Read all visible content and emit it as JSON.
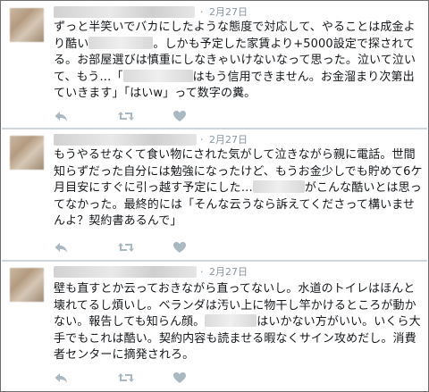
{
  "tweets": [
    {
      "date": "2月27日",
      "text": [
        "ずっと半笑いでバカにしたような態度で対応して、やることは成金より酷い",
        "。しかも予定した家賃より+5000設定で探されてる。お部屋選びは慎重にしなきゃいけないなって思った。泣いて泣いて、もう…「",
        "はもう信用できません。お金溜まり次第出ていきます」「はいw」って数字の糞。"
      ]
    },
    {
      "date": "2月27日",
      "text": [
        "もうやるせなくて食い物にされた気がして泣きながら親に電話。世間知らずだった自分には勉強になったけど、もうお金少しでも貯めて6ケ月目安にすぐに引っ越す予定にした…",
        "がこんな酷いとは思ってなかった。最終的には「そんな云うなら訴えてくださって構いませんよ？契約書あるんで」"
      ]
    },
    {
      "date": "2月27日",
      "text": [
        "壁も直すとか云っておきながら直ってないし。水道のトイレはほんと壊れてるし煩いし。ベランダは汚い上に物干し竿かけるところが動かない。報告しても知らん顔。",
        "はいかない方がいい。いくら大手でもこれは酷い。契約内容も読ませる暇なくサイン攻めだし。消費者センターに摘発されろ。"
      ]
    }
  ],
  "icons": {
    "reply": "reply-icon",
    "retweet": "retweet-icon",
    "like": "heart-icon"
  },
  "colors": {
    "text": "#14171a",
    "meta": "#8a959e",
    "icon": "#aab8c2",
    "divider": "#cfd6dc"
  }
}
